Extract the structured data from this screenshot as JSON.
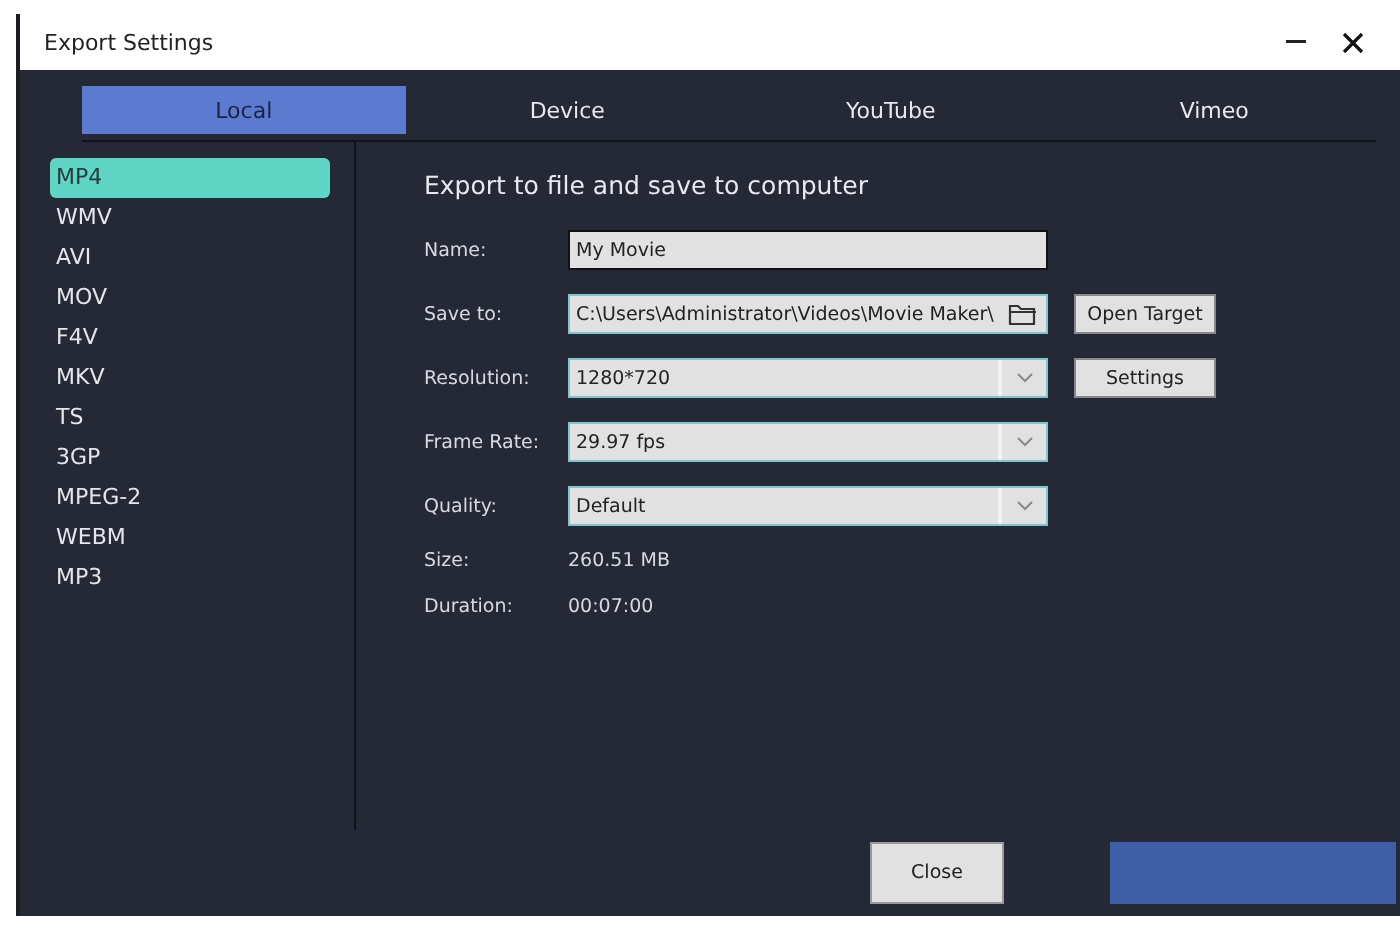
{
  "window": {
    "title": "Export Settings"
  },
  "tabs": [
    {
      "label": "Local",
      "selected": true
    },
    {
      "label": "Device",
      "selected": false
    },
    {
      "label": "YouTube",
      "selected": false
    },
    {
      "label": "Vimeo",
      "selected": false
    }
  ],
  "formats": [
    {
      "label": "MP4",
      "selected": true
    },
    {
      "label": "WMV",
      "selected": false
    },
    {
      "label": "AVI",
      "selected": false
    },
    {
      "label": "MOV",
      "selected": false
    },
    {
      "label": "F4V",
      "selected": false
    },
    {
      "label": "MKV",
      "selected": false
    },
    {
      "label": "TS",
      "selected": false
    },
    {
      "label": "3GP",
      "selected": false
    },
    {
      "label": "MPEG-2",
      "selected": false
    },
    {
      "label": "WEBM",
      "selected": false
    },
    {
      "label": "MP3",
      "selected": false
    }
  ],
  "heading": "Export to file and save to computer",
  "fields": [
    {
      "kind": "text",
      "label": "Name:",
      "value": "My Movie"
    },
    {
      "kind": "path",
      "label": "Save to:",
      "value": "C:\\Users\\Administrator\\Videos\\Movie Maker\\",
      "button": "Open Target"
    },
    {
      "kind": "dropdown",
      "label": "Resolution:",
      "value": "1280*720",
      "button": "Settings"
    },
    {
      "kind": "dropdown",
      "label": "Frame Rate:",
      "value": "29.97 fps"
    },
    {
      "kind": "dropdown",
      "label": "Quality:",
      "value": "Default"
    },
    {
      "kind": "info",
      "label": "Size:",
      "value": "260.51 MB"
    },
    {
      "kind": "info",
      "label": "Duration:",
      "value": "00:07:00"
    }
  ],
  "buttons": [
    {
      "kind": "secondary",
      "label": "Close"
    },
    {
      "kind": "primary"
    }
  ]
}
